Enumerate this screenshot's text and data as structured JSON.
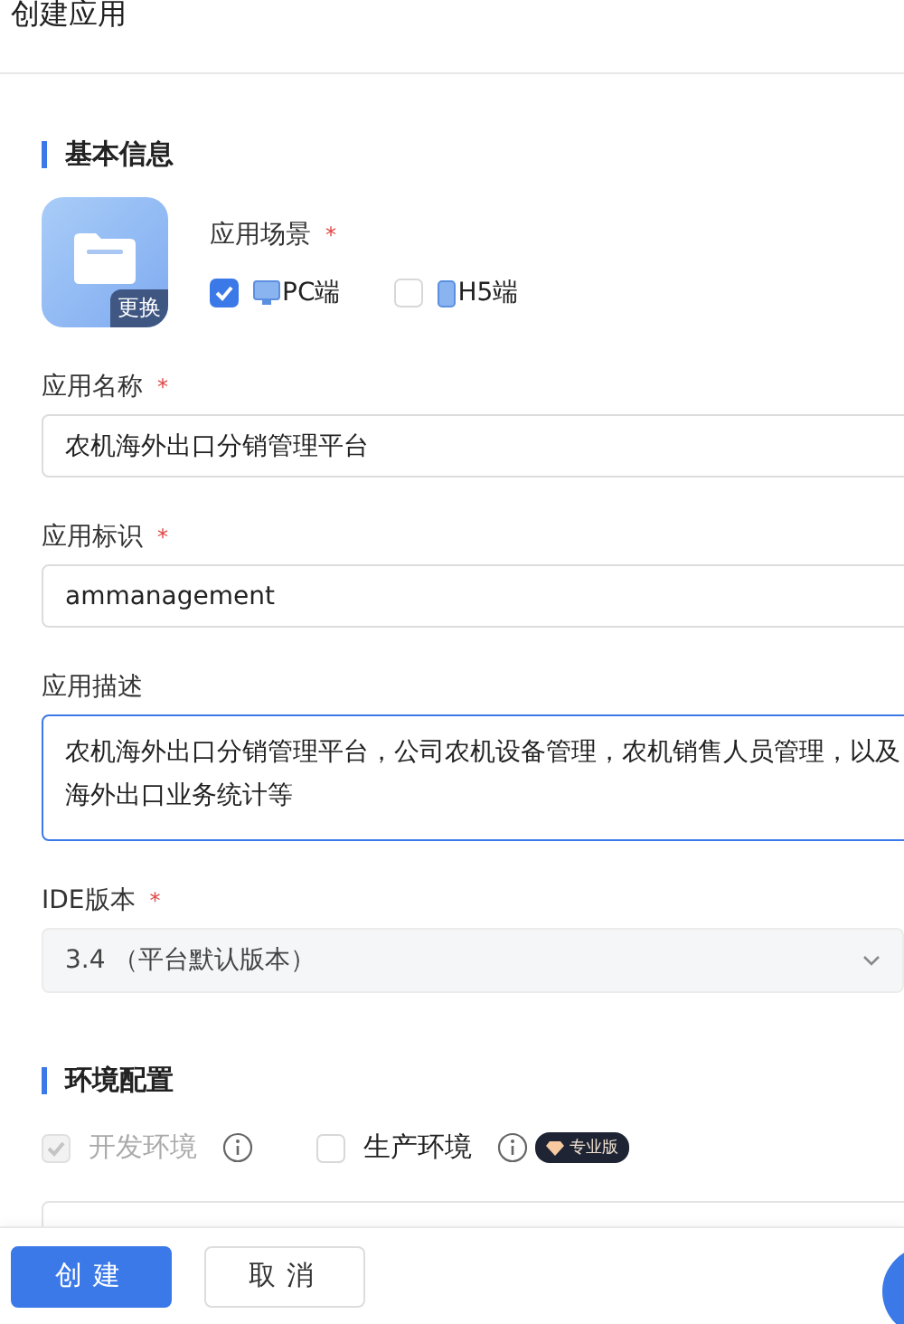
{
  "header": {
    "title": "创建应用"
  },
  "basic_section": {
    "title": "基本信息",
    "app_icon": {
      "change_label": "更换"
    },
    "scene": {
      "label": "应用场景",
      "required_mark": "*",
      "options": [
        {
          "label": "PC端",
          "checked": true,
          "kind": "pc"
        },
        {
          "label": "H5端",
          "checked": false,
          "kind": "h5"
        }
      ]
    }
  },
  "fields": [
    {
      "label": "应用名称",
      "required_mark": "*",
      "value": "农机海外出口分销管理平台",
      "kind": "input",
      "focused": false
    },
    {
      "label": "应用标识",
      "required_mark": "*",
      "value": "ammanagement",
      "kind": "input",
      "focused": false
    },
    {
      "label": "应用描述",
      "value": "农机海外出口分销管理平台，公司农机设备管理，农机销售人员管理，以及海外出口业务统计等",
      "kind": "textarea",
      "focused": true
    },
    {
      "label": "IDE版本",
      "required_mark": "*",
      "value": "3.4 （平台默认版本）",
      "kind": "select",
      "focused": false
    }
  ],
  "env_section": {
    "title": "环境配置",
    "options": [
      {
        "label": "开发环境",
        "checked": true,
        "disabled": true
      },
      {
        "label": "生产环境",
        "checked": false,
        "disabled": false,
        "badge": "专业版"
      }
    ]
  },
  "buttons": [
    {
      "label": "创建",
      "kind": "primary"
    },
    {
      "label": "取消",
      "kind": "default"
    }
  ]
}
